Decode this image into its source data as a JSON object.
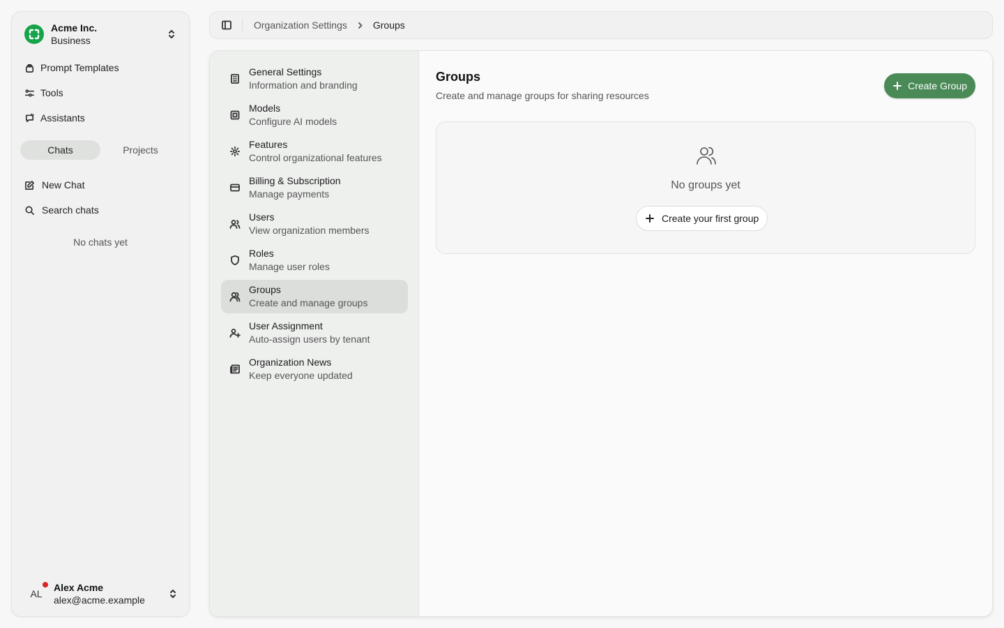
{
  "org": {
    "name": "Acme Inc.",
    "plan": "Business",
    "logo_color": "#16a34a"
  },
  "sidebar": {
    "nav": [
      {
        "label": "Prompt Templates",
        "icon": "templates-icon"
      },
      {
        "label": "Tools",
        "icon": "tools-icon"
      },
      {
        "label": "Assistants",
        "icon": "assistants-icon"
      }
    ],
    "tabs": [
      {
        "label": "Chats",
        "active": true
      },
      {
        "label": "Projects",
        "active": false
      }
    ],
    "actions": [
      {
        "label": "New Chat",
        "icon": "edit-icon"
      },
      {
        "label": "Search chats",
        "icon": "search-icon"
      }
    ],
    "empty_text": "No chats yet"
  },
  "user": {
    "initials": "AL",
    "name": "Alex Acme",
    "email": "alex@acme.example",
    "status_color": "#dc2626"
  },
  "breadcrumb": {
    "parent": "Organization Settings",
    "current": "Groups"
  },
  "settings_nav": [
    {
      "label": "General Settings",
      "desc": "Information and branding",
      "icon": "building-icon"
    },
    {
      "label": "Models",
      "desc": "Configure AI models",
      "icon": "models-icon"
    },
    {
      "label": "Features",
      "desc": "Control organizational features",
      "icon": "gear-icon"
    },
    {
      "label": "Billing & Subscription",
      "desc": "Manage payments",
      "icon": "credit-card-icon"
    },
    {
      "label": "Users",
      "desc": "View organization members",
      "icon": "users-icon"
    },
    {
      "label": "Roles",
      "desc": "Manage user roles",
      "icon": "shield-icon"
    },
    {
      "label": "Groups",
      "desc": "Create and manage groups",
      "icon": "groups-icon",
      "active": true
    },
    {
      "label": "User Assignment",
      "desc": "Auto-assign users by tenant",
      "icon": "user-plus-icon"
    },
    {
      "label": "Organization News",
      "desc": "Keep everyone updated",
      "icon": "newspaper-icon"
    }
  ],
  "page": {
    "title": "Groups",
    "subtitle": "Create and manage groups for sharing resources",
    "create_button": "Create Group",
    "accent_color": "#4a8a57",
    "empty_text": "No groups yet",
    "first_button": "Create your first group"
  }
}
